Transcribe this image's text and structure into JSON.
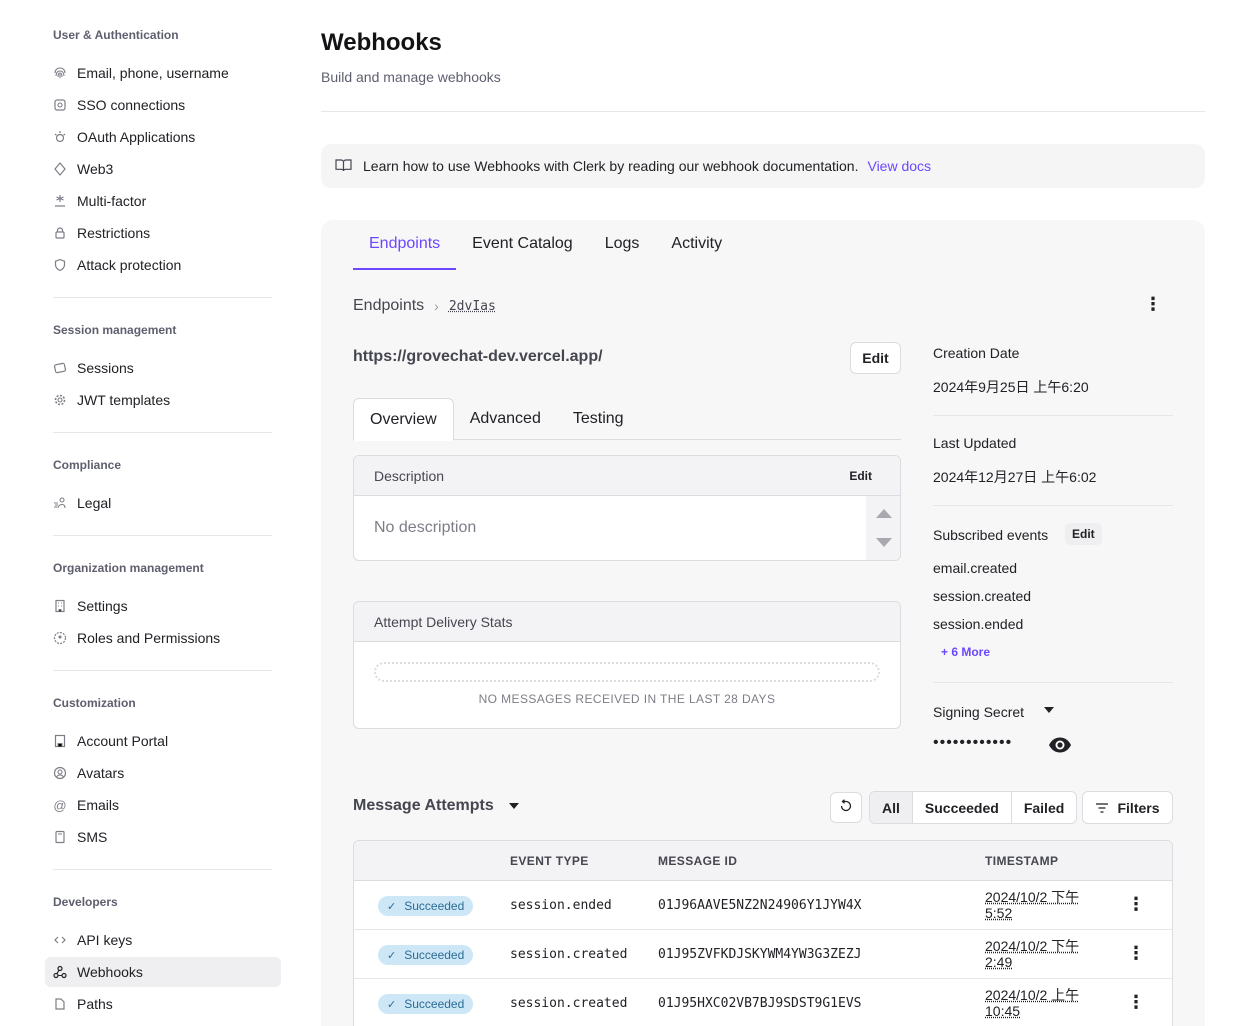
{
  "sidebar": {
    "sections": [
      {
        "title": "User & Authentication",
        "items": [
          {
            "label": "Email, phone, username",
            "icon": "fingerprint-icon"
          },
          {
            "label": "SSO connections",
            "icon": "sso-icon"
          },
          {
            "label": "OAuth Applications",
            "icon": "oauth-icon"
          },
          {
            "label": "Web3",
            "icon": "web3-icon"
          },
          {
            "label": "Multi-factor",
            "icon": "asterisk-icon"
          },
          {
            "label": "Restrictions",
            "icon": "lock-icon"
          },
          {
            "label": "Attack protection",
            "icon": "shield-icon"
          }
        ]
      },
      {
        "title": "Session management",
        "items": [
          {
            "label": "Sessions",
            "icon": "sessions-icon"
          },
          {
            "label": "JWT templates",
            "icon": "gear-icon"
          }
        ]
      },
      {
        "title": "Compliance",
        "items": [
          {
            "label": "Legal",
            "icon": "legal-icon"
          }
        ]
      },
      {
        "title": "Organization management",
        "items": [
          {
            "label": "Settings",
            "icon": "building-icon"
          },
          {
            "label": "Roles and Permissions",
            "icon": "roles-icon"
          }
        ]
      },
      {
        "title": "Customization",
        "items": [
          {
            "label": "Account Portal",
            "icon": "portal-icon"
          },
          {
            "label": "Avatars",
            "icon": "avatar-icon"
          },
          {
            "label": "Emails",
            "icon": "at-icon"
          },
          {
            "label": "SMS",
            "icon": "sms-icon"
          }
        ]
      },
      {
        "title": "Developers",
        "items": [
          {
            "label": "API keys",
            "icon": "code-icon"
          },
          {
            "label": "Webhooks",
            "icon": "webhook-icon",
            "active": true
          },
          {
            "label": "Paths",
            "icon": "paths-icon"
          }
        ]
      }
    ]
  },
  "header": {
    "title": "Webhooks",
    "subtitle": "Build and manage webhooks"
  },
  "banner": {
    "text": "Learn how to use Webhooks with Clerk by reading our webhook documentation.",
    "link": "View docs"
  },
  "tabs": [
    "Endpoints",
    "Event Catalog",
    "Logs",
    "Activity"
  ],
  "breadcrumb": {
    "root": "Endpoints",
    "id": "2dvIas"
  },
  "endpoint": {
    "url": "https://grovechat-dev.vercel.app/",
    "edit_label": "Edit"
  },
  "subtabs": [
    "Overview",
    "Advanced",
    "Testing"
  ],
  "description_card": {
    "title": "Description",
    "edit_label": "Edit",
    "empty": "No description"
  },
  "stats_card": {
    "title": "Attempt Delivery Stats",
    "empty": "NO MESSAGES RECEIVED IN THE LAST 28 DAYS"
  },
  "meta": {
    "creation_label": "Creation Date",
    "creation_value": "2024年9月25日 上午6:20",
    "updated_label": "Last Updated",
    "updated_value": "2024年12月27日 上午6:02",
    "subscribed_label": "Subscribed events",
    "subscribed_edit": "Edit",
    "events": [
      "email.created",
      "session.created",
      "session.ended"
    ],
    "more": "+ 6 More",
    "secret_label": "Signing Secret",
    "secret_masked": "••••••••••••"
  },
  "attempts": {
    "title": "Message Attempts",
    "filters": [
      "All",
      "Succeeded",
      "Failed"
    ],
    "filters_button": "Filters",
    "columns": [
      "EVENT TYPE",
      "MESSAGE ID",
      "TIMESTAMP"
    ],
    "rows": [
      {
        "status": "Succeeded",
        "event": "session.ended",
        "message_id": "01J96AAVE5NZ2N24906Y1JYW4X",
        "timestamp": "2024/10/2 下午5:52"
      },
      {
        "status": "Succeeded",
        "event": "session.created",
        "message_id": "01J95ZVFKDJSKYWM4YW3G3ZEZJ",
        "timestamp": "2024/10/2 下午2:49"
      },
      {
        "status": "Succeeded",
        "event": "session.created",
        "message_id": "01J95HXC02VB7BJ9SDST9G1EVS",
        "timestamp": "2024/10/2 上午10:45"
      }
    ]
  },
  "colors": {
    "accent": "#6c47ff",
    "badge_bg": "#cde7f7",
    "badge_text": "#2a6c94"
  }
}
